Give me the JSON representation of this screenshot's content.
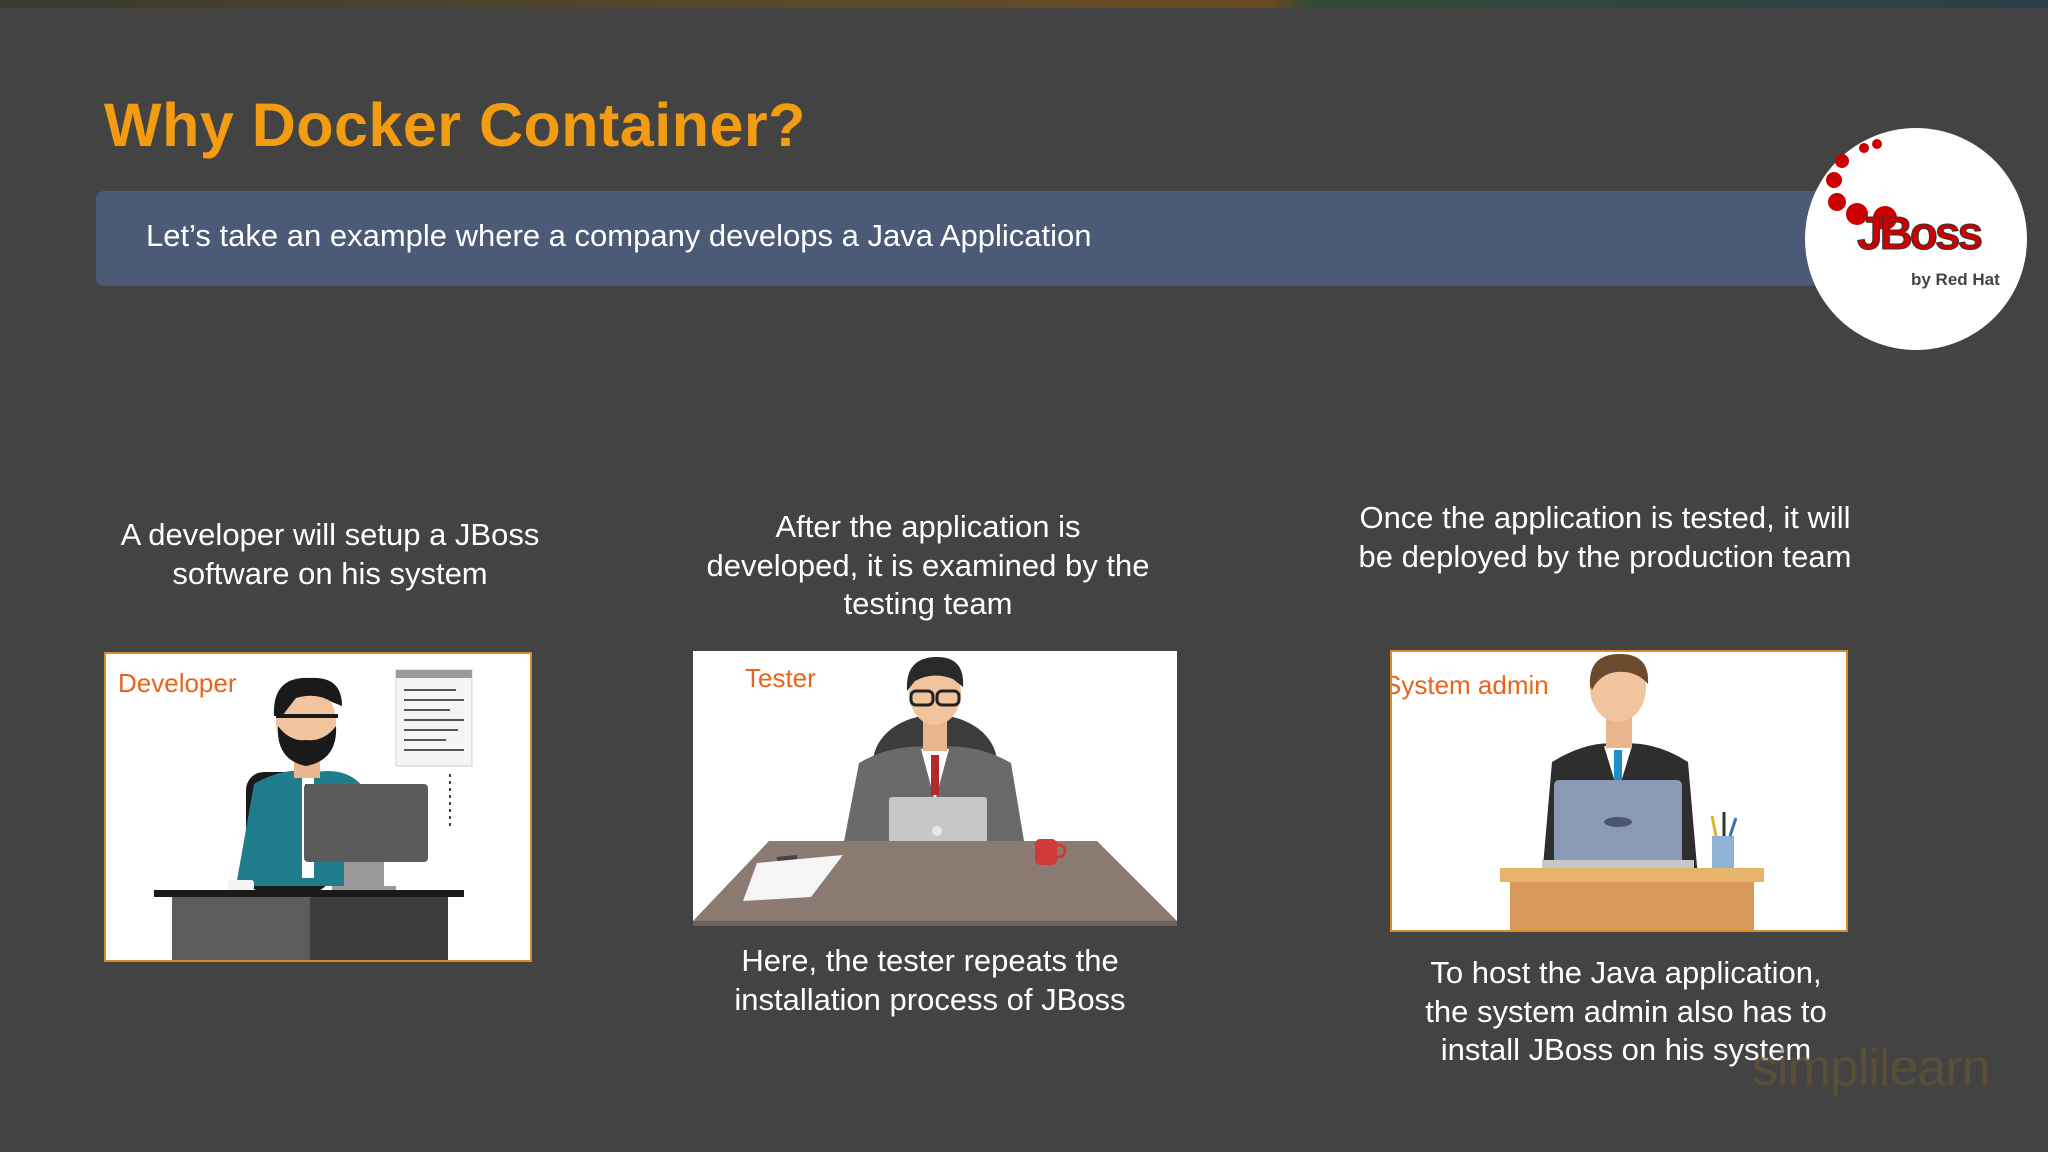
{
  "slide": {
    "title": "Why Docker Container?",
    "banner_text": "Let’s take an example where a company develops a Java Application",
    "accent_color": "#f39c12",
    "banner_color": "#4b5a77",
    "background_color": "#434343"
  },
  "logo": {
    "brand": "JBoss",
    "tagline": "by Red Hat",
    "icon": "jboss-logo-icon"
  },
  "steps": [
    {
      "caption": [
        "A developer will setup a JBoss",
        "software on his system"
      ],
      "role": "Developer",
      "illustration": "developer-at-desk-illustration"
    },
    {
      "caption": [
        "After the application is",
        "developed, it is examined by the",
        "testing team"
      ],
      "role": "Tester",
      "illustration": "tester-at-desk-illustration",
      "footer": [
        "Here, the tester repeats the",
        "installation process of JBoss"
      ]
    },
    {
      "caption": [
        "Once the application is tested, it will",
        "be deployed by the production team"
      ],
      "role": "System admin",
      "illustration": "sysadmin-at-desk-illustration",
      "footer": [
        "To host the Java application,",
        "the system admin also has to",
        "install JBoss on his system"
      ]
    }
  ],
  "watermark": "simplilearn"
}
